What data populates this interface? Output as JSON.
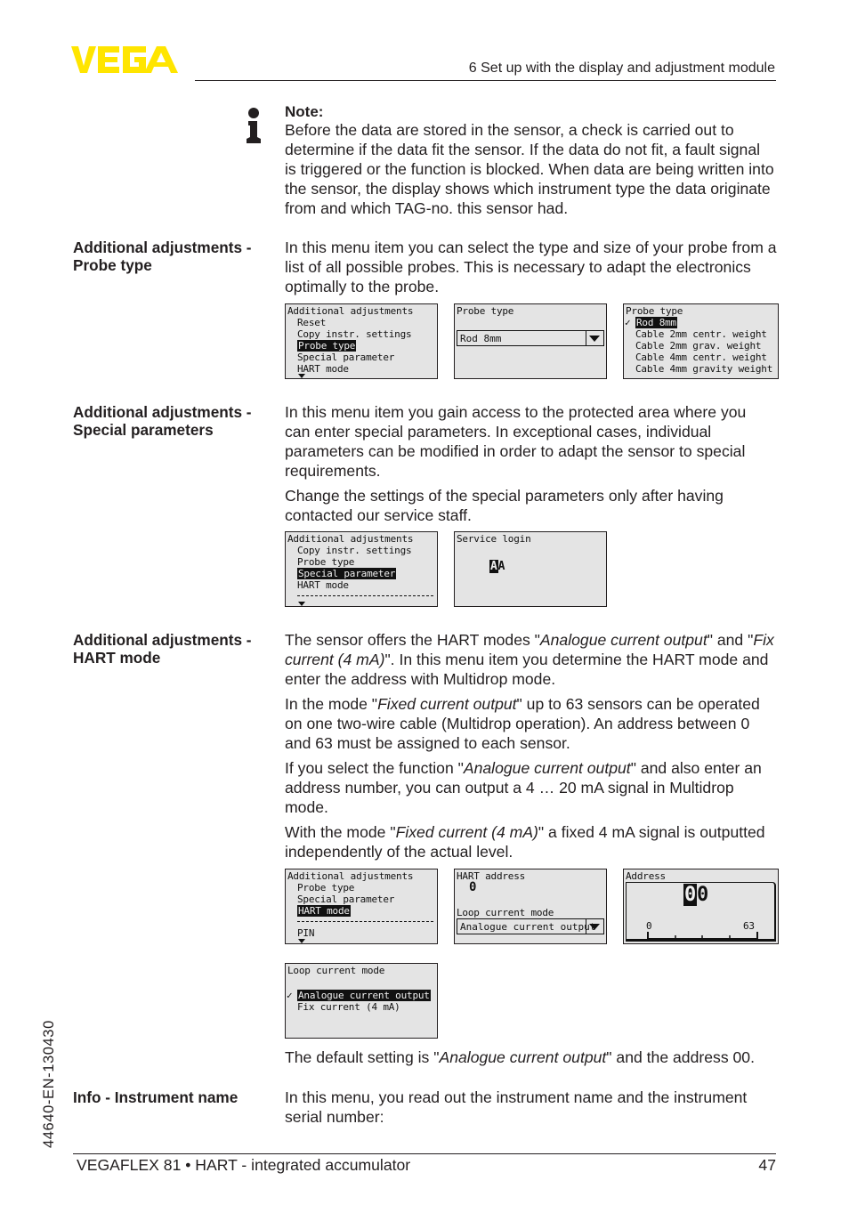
{
  "header": {
    "logo_text": "VEGA",
    "logo_color": "#ffe500",
    "section_title": "6 Set up with the display and adjustment module"
  },
  "note": {
    "icon": "info-icon",
    "title": "Note:",
    "text": "Before the data are stored in the sensor, a check is carried out to determine if the data fit the sensor. If the data do not fit, a fault signal is triggered or the function is blocked. When data are being written into the sensor, the display shows which instrument type the data originate from and which TAG-no. this sensor had."
  },
  "sections": {
    "probe_type": {
      "label_line1": "Additional adjustments -",
      "label_line2": "Probe type",
      "text": "In this menu item you can select the type and size of your probe from a list of all possible probes. This is necessary to adapt the electronics optimally to the probe.",
      "screens": {
        "menu": {
          "title": "Additional adjustments",
          "items": [
            "Reset",
            "Copy instr. settings",
            "Probe type",
            "Special parameter",
            "HART mode"
          ],
          "selected": "Probe type"
        },
        "select": {
          "title": "Probe type",
          "value": "Rod 8mm"
        },
        "list": {
          "title": "Probe type",
          "checkmark": "✓",
          "items": [
            "Rod 8mm",
            "Cable 2mm centr. weight",
            "Cable 2mm grav. weight",
            "Cable 4mm centr. weight",
            "Cable 4mm gravity weight"
          ],
          "selected": "Rod 8mm"
        }
      }
    },
    "special_parameters": {
      "label_line1": "Additional adjustments -",
      "label_line2": "Special parameters",
      "paragraph1": "In this menu item you gain access to the protected area where you can enter special parameters. In exceptional cases, individual parameters can be modified in order to adapt the sensor to special requirements.",
      "paragraph2": "Change the settings of the special parameters only after having contacted our service staff.",
      "screens": {
        "menu": {
          "title": "Additional adjustments",
          "items": [
            "Copy instr. settings",
            "Probe type",
            "Special parameter",
            "HART mode"
          ],
          "selected": "Special parameter"
        },
        "login": {
          "title": "Service login",
          "cursor_char": "A",
          "char": "A"
        }
      }
    },
    "hart_mode": {
      "label_line1": "Additional adjustments -",
      "label_line2": "HART mode",
      "p1_a": "The sensor offers the HART modes \"",
      "p1_i1": "Analogue current output",
      "p1_b": "\" and \"",
      "p1_i2": "Fix current (4 mA)",
      "p1_c": "\". In this menu item you determine the HART mode and enter the address with  Multidrop mode.",
      "p2_a": "In the mode \"",
      "p2_i": "Fixed current output",
      "p2_b": "\" up to 63 sensors can be operated on one two-wire cable (Multidrop operation). An address between 0 and 63 must be assigned to each sensor.",
      "p3_a": "If you select the function \"",
      "p3_i": "Analogue current output",
      "p3_b": "\" and also enter an address number, you can output a 4 … 20 mA signal in Multidrop mode.",
      "p4_a": "With the mode \"",
      "p4_i": "Fixed current (4 mA)",
      "p4_b": "\" a fixed 4 mA signal is outputted independently of the actual level.",
      "p5_a": "The default setting is \"",
      "p5_i": "Analogue current output",
      "p5_b": "\" and the address 00.",
      "screens": {
        "menu": {
          "title": "Additional adjustments",
          "items": [
            "Probe type",
            "Special parameter",
            "HART mode",
            "PIN"
          ],
          "selected": "HART mode"
        },
        "hart_address": {
          "title": "HART address",
          "address_value": "0",
          "loop_label": "Loop current mode",
          "loop_value": "Analogue current output"
        },
        "address": {
          "title": "Address",
          "digit1": "0",
          "digit2": "0",
          "scale_min": "0",
          "scale_max": "63"
        },
        "loop_mode": {
          "title": "Loop current mode",
          "checkmark": "✓",
          "items": [
            "Analogue current output",
            "Fix current (4 mA)"
          ],
          "selected": "Analogue current output"
        }
      }
    },
    "instrument_name": {
      "label": "Info - Instrument name",
      "text": "In this menu, you read out the instrument name and the instrument serial number:"
    }
  },
  "footer": {
    "product": "VEGAFLEX 81 • HART - integrated accumulator",
    "page_number": "47",
    "doc_code": "44640-EN-130430"
  }
}
